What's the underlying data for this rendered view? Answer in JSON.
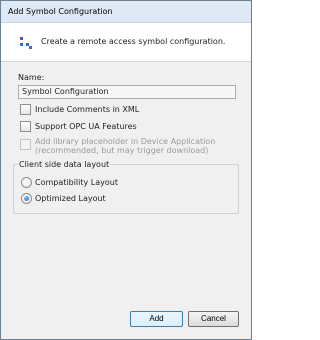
{
  "window": {
    "title": "Add Symbol Configuration"
  },
  "banner": {
    "icon": "symbol-config-icon",
    "text": "Create a remote access symbol configuration."
  },
  "name_field": {
    "label": "Name:",
    "value": "Symbol Configuration"
  },
  "options": [
    {
      "label": "Include Comments in XML",
      "checked": false,
      "enabled": true
    },
    {
      "label": "Support OPC UA Features",
      "checked": false,
      "enabled": true
    },
    {
      "label_line1": "Add library placeholder in Device Application",
      "label_line2": "(recommended, but may trigger download)",
      "checked": false,
      "enabled": false
    }
  ],
  "layout_group": {
    "title": "Client side data layout",
    "radios": [
      {
        "label": "Compatibility Layout",
        "selected": false
      },
      {
        "label": "Optimized Layout",
        "selected": true
      }
    ]
  },
  "buttons": {
    "add": "Add",
    "cancel": "Cancel"
  },
  "colors": {
    "title_bar": "#dfe9f5",
    "dialog_bg": "#f0f0f0",
    "default_button_border": "#3c7fb1"
  }
}
